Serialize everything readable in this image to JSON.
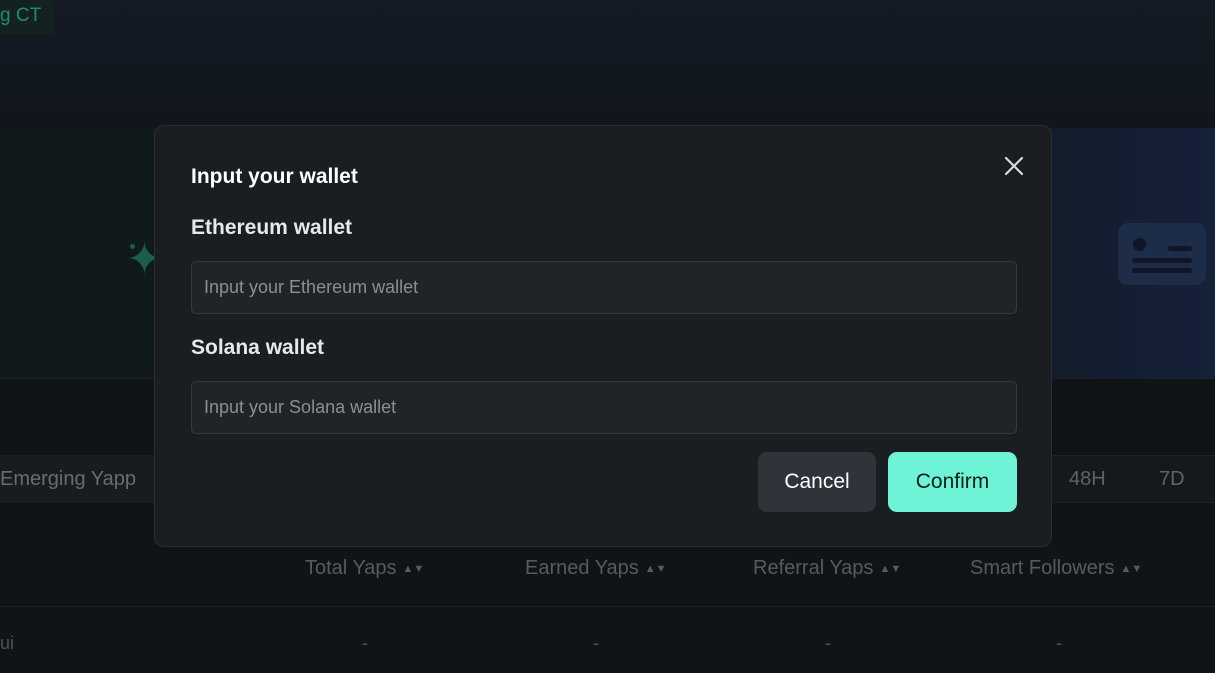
{
  "background": {
    "top_tag": "g CT",
    "filter_tab": "Emerging Yapp",
    "timeframes": [
      "48H",
      "7D"
    ],
    "table_headers": [
      "Total Yaps",
      "Earned Yaps",
      "Referral Yaps",
      "Smart Followers"
    ],
    "row": {
      "name_fragment": "ui",
      "values": [
        "-",
        "-",
        "-",
        "-"
      ]
    }
  },
  "modal": {
    "title": "Input your wallet",
    "ethereum": {
      "label": "Ethereum wallet",
      "placeholder": "Input your Ethereum wallet",
      "value": ""
    },
    "solana": {
      "label": "Solana wallet",
      "placeholder": "Input your Solana wallet",
      "value": ""
    },
    "cancel_label": "Cancel",
    "confirm_label": "Confirm",
    "close_icon": "close-icon"
  },
  "colors": {
    "accent": "#6ff3d6",
    "modal_bg": "#1b1e21",
    "page_bg": "#101417",
    "cancel_bg": "#2f333a"
  }
}
